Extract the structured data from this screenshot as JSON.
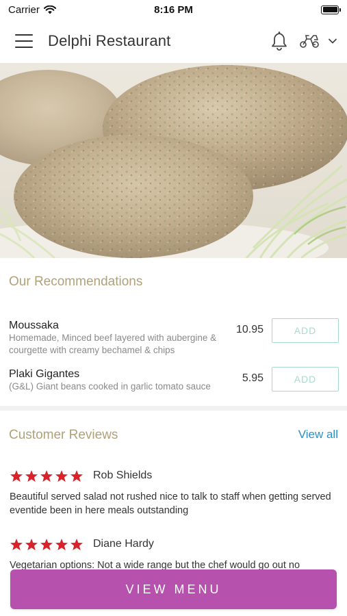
{
  "status_bar": {
    "carrier": "Carrier",
    "time": "8:16 PM",
    "battery_level": 1.0
  },
  "header": {
    "title": "Delphi Restaurant",
    "icons": [
      "menu-icon",
      "bell-icon",
      "delivery-scooter-icon",
      "chevron-down-icon"
    ]
  },
  "recommendations": {
    "title": "Our Recommendations",
    "add_label": "ADD",
    "items": [
      {
        "name": "Moussaka",
        "description": "Homemade, Minced beef layered with aubergine & courgette with creamy bechamel & chips",
        "price": "10.95"
      },
      {
        "name": "Plaki Gigantes",
        "description": "(G&L) Giant beans cooked in garlic tomato sauce",
        "price": "5.95"
      }
    ]
  },
  "reviews": {
    "title": "Customer Reviews",
    "view_all_label": "View all",
    "items": [
      {
        "reviewer": "Rob Shields",
        "rating": 5,
        "text": "Beautiful  served salad not rushed nice to talk to staff when getting served eventide been in here meals outstanding"
      },
      {
        "reviewer": "Diane Hardy",
        "rating": 5,
        "text": "Vegetarian options: Not a wide range but the chef would go out no"
      }
    ]
  },
  "footer": {
    "view_menu_label": "VIEW MENU"
  },
  "colors": {
    "accent_purple": "#b651ad",
    "section_title": "#b0a17a",
    "add_button": "#a9dcc7",
    "link_blue": "#2b8fc8",
    "star_red": "#d8232a"
  }
}
